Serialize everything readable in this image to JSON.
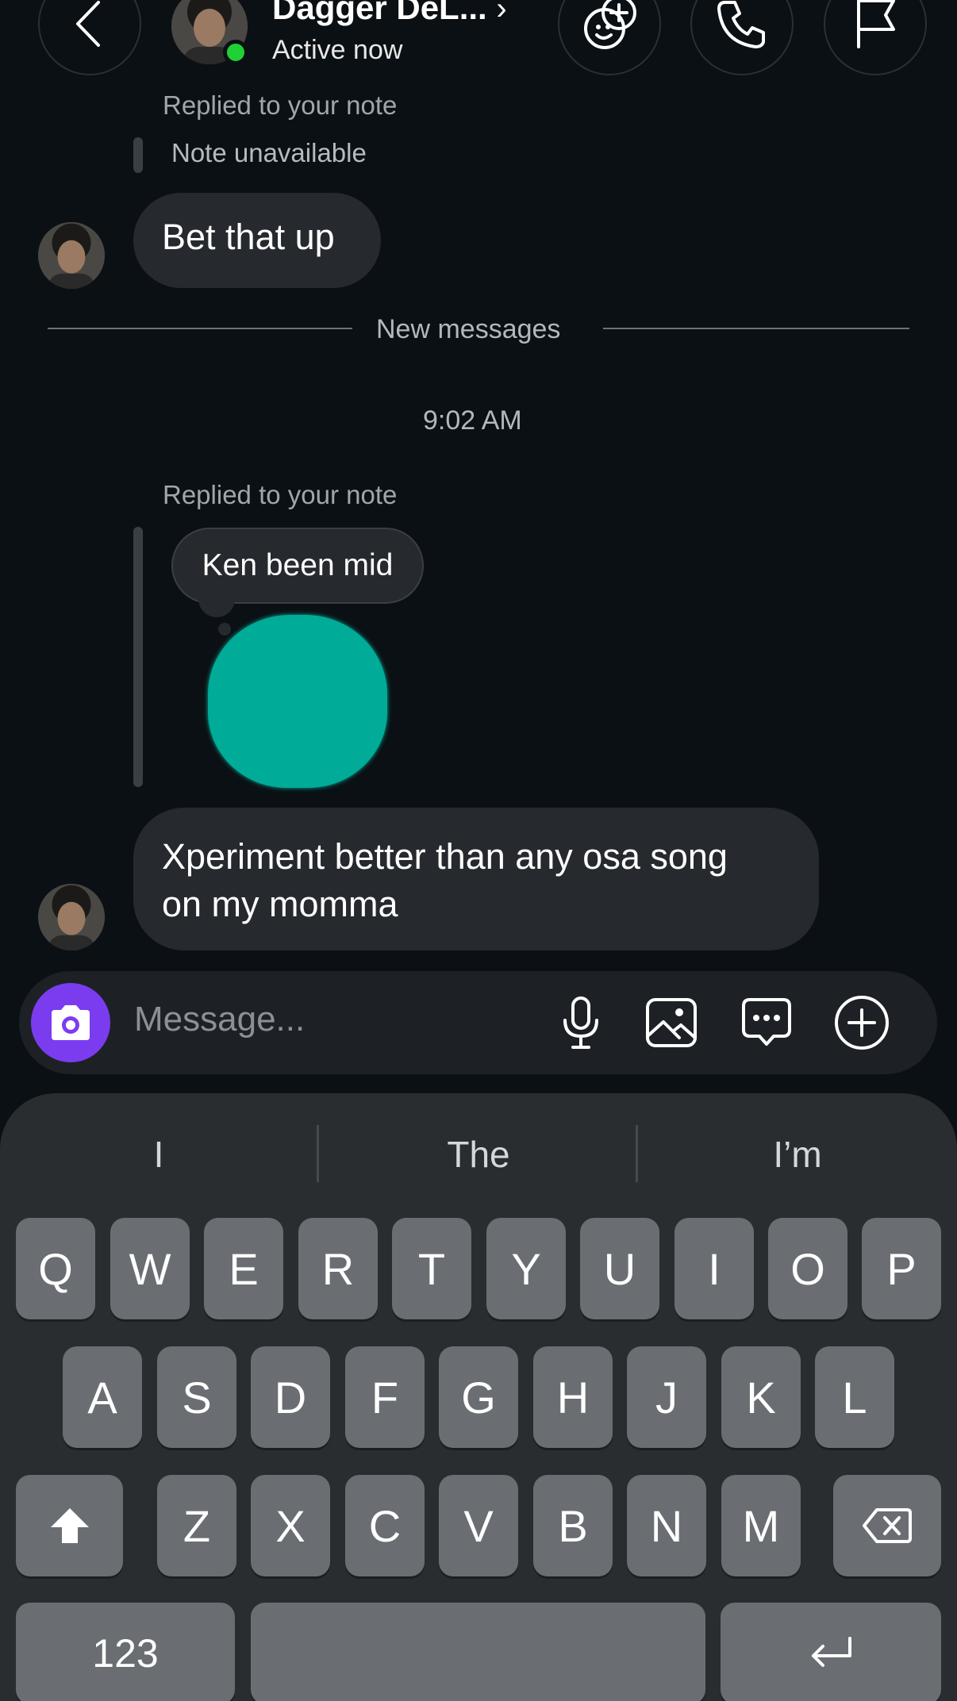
{
  "header": {
    "contact_name": "Dagger DeL...",
    "chevron": "›",
    "status": "Active now",
    "icons": [
      "back-icon",
      "effects-icon",
      "phone-icon",
      "flag-icon"
    ]
  },
  "messages": {
    "reply1_label": "Replied to your note",
    "reply1_note": "Note unavailable",
    "msg1": "Bet that up",
    "divider": "New messages",
    "timestamp": "9:02 AM",
    "reply2_label": "Replied to your note",
    "reply2_note": "Ken been mid",
    "msg2_line1": "Xperiment better than any osa song",
    "msg2_line2": "on my momma"
  },
  "composer": {
    "placeholder": "Message...",
    "accent": "#7b3cf0",
    "icons": [
      "camera-icon",
      "microphone-icon",
      "gallery-icon",
      "chat-bubble-icon",
      "plus-icon"
    ]
  },
  "keyboard": {
    "suggestions": [
      "I",
      "The",
      "I’m"
    ],
    "row1": [
      "Q",
      "W",
      "E",
      "R",
      "T",
      "Y",
      "U",
      "I",
      "O",
      "P"
    ],
    "row2": [
      "A",
      "S",
      "D",
      "F",
      "G",
      "H",
      "J",
      "K",
      "L"
    ],
    "row3": [
      "Z",
      "X",
      "C",
      "V",
      "B",
      "N",
      "M"
    ],
    "numbers_key": "123"
  },
  "colors": {
    "background": "#0b1014",
    "bubble": "#262a2e",
    "note_blob": "#00ab98",
    "online": "#1fd134"
  }
}
